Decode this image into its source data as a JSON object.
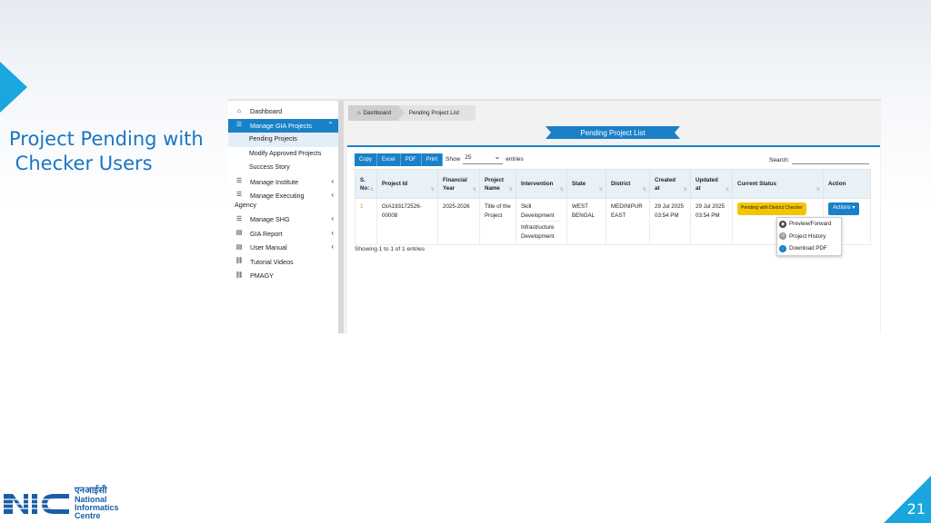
{
  "slide": {
    "title_line1": "Project Pending with",
    "title_line2": " Checker Users",
    "page_number": "21",
    "accent_color": "#1aa6de"
  },
  "logo": {
    "hindi": "एनआईसी",
    "line1": "National",
    "line2": "Informatics",
    "line3": "Centre"
  },
  "sidebar": {
    "items": [
      {
        "label": "Dashboard",
        "icon": "home-icon"
      },
      {
        "label": "Manage GIA Projects",
        "icon": "list-icon",
        "active": true
      },
      {
        "label": "Manage Institute",
        "icon": "list-icon"
      },
      {
        "label": "Manage Executing",
        "label2": "Agency",
        "icon": "list-icon"
      },
      {
        "label": "Manage SHG",
        "icon": "list-icon"
      },
      {
        "label": "GIA Report",
        "icon": "file-icon"
      },
      {
        "label": "User Manual",
        "icon": "file-icon"
      },
      {
        "label": "Tutorial Videos",
        "icon": "link-icon"
      },
      {
        "label": "PMAGY",
        "icon": "link-icon"
      }
    ],
    "subitems": [
      "Pending Projects",
      "Modify Approved Projects",
      "Success Story"
    ]
  },
  "breadcrumb": {
    "home": "Dashboard",
    "current": "Pending Project List"
  },
  "page_heading": "Pending Project List",
  "toolbar": {
    "buttons": [
      "Copy",
      "Excel",
      "PDF",
      "Print"
    ],
    "show_label": "Show",
    "entries_value": "25",
    "entries_label": "entries",
    "search_label": "Search:"
  },
  "table": {
    "headers": [
      "S.\nNo:",
      "Project Id",
      "Financial\nYear",
      "Project\nName",
      "Intervention",
      "State",
      "District",
      "Created\nat",
      "Updated\nat",
      "Current Status",
      "Action"
    ],
    "rows": [
      {
        "sno": "1",
        "project_id": "GIA193172526-00008",
        "financial_year": "2025-2026",
        "project_name": "Title of the Project",
        "intervention1": "Skill Development",
        "intervention2": "Infrastructure Development",
        "state": "WEST BENGAL",
        "district": "MEDINIPUR EAST",
        "created_at": "29 Jul 2025 03:54 PM",
        "updated_at": "29 Jul 2025 03:54 PM",
        "status": "Pending with District Checker",
        "action_label": "Actions ▾"
      }
    ],
    "footer": "Showing 1 to 1 of 1 entries"
  },
  "actions_menu": [
    "Preview/Forward",
    "Project History",
    "Download PDF"
  ],
  "colors": {
    "primary": "#1a80c8",
    "status_badge": "#f5c400"
  }
}
